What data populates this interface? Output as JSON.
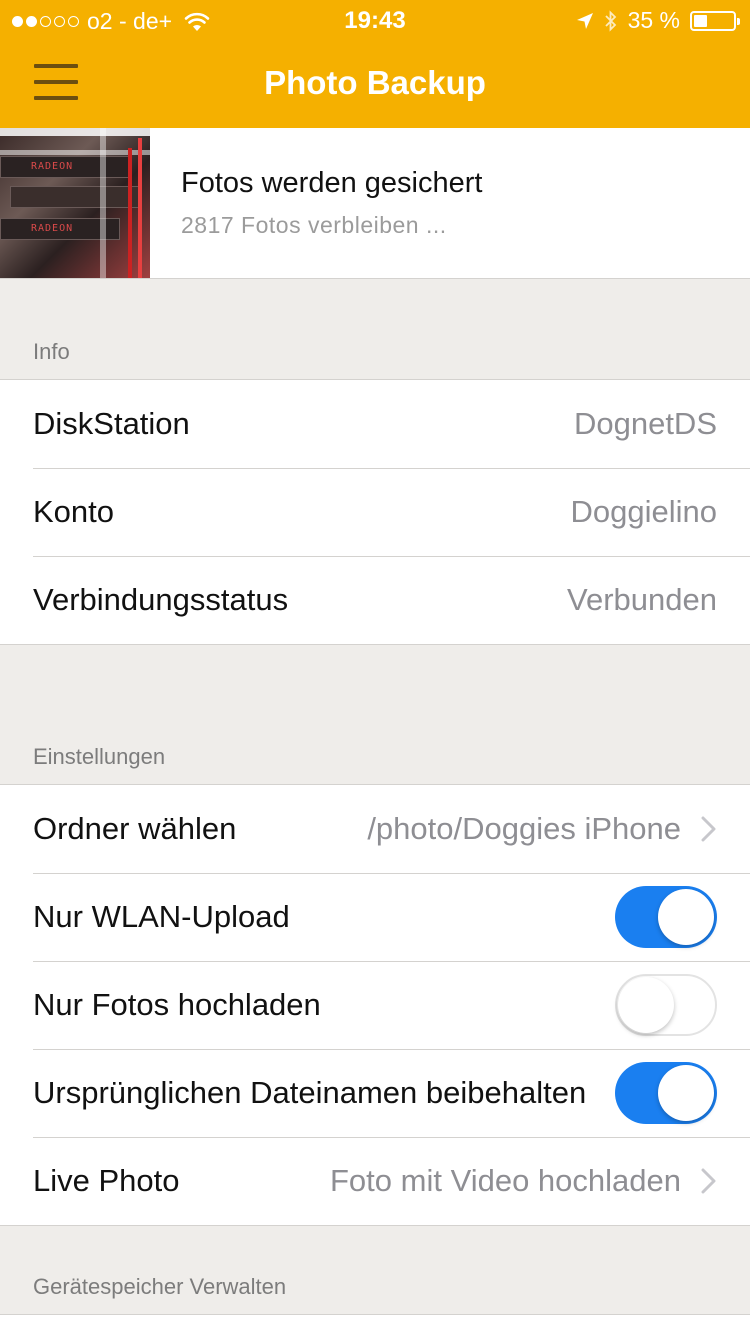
{
  "status_bar": {
    "carrier": "o2 - de+",
    "time": "19:43",
    "battery": "35 %",
    "battery_level": 0.35
  },
  "nav": {
    "title": "Photo Backup"
  },
  "backup": {
    "title": "Fotos werden gesichert",
    "subtitle": "2817 Fotos verbleiben ...",
    "thumb_text": "RADEON"
  },
  "info": {
    "header": "Info",
    "rows": [
      {
        "label": "DiskStation",
        "value": "DognetDS"
      },
      {
        "label": "Konto",
        "value": "Doggielino"
      },
      {
        "label": "Verbindungsstatus",
        "value": "Verbunden"
      }
    ]
  },
  "settings": {
    "header": "Einstellungen",
    "folder": {
      "label": "Ordner wählen",
      "value": "/photo/Doggies iPhone"
    },
    "wlan": {
      "label": "Nur WLAN-Upload",
      "on": true
    },
    "photos_only": {
      "label": "Nur Fotos hochladen",
      "on": false
    },
    "filenames": {
      "label": "Ursprünglichen Dateinamen beibehalten",
      "on": true
    },
    "live_photo": {
      "label": "Live Photo",
      "value": "Foto mit Video hochladen"
    }
  },
  "storage": {
    "header": "Gerätespeicher Verwalten"
  },
  "colors": {
    "accent": "#f5b000",
    "toggle_on": "#1a7ff0",
    "background": "#efedea"
  }
}
